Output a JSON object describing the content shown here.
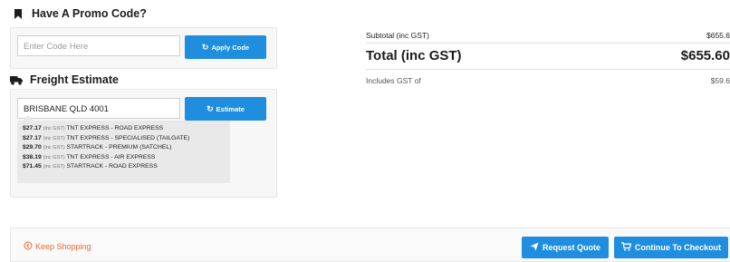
{
  "promo": {
    "title": "Have A Promo Code?",
    "input_placeholder": "Enter Code Here",
    "button_label": "Apply Code"
  },
  "freight": {
    "title": "Freight Estimate",
    "postcode_value": "BRISBANE QLD 4001",
    "button_label": "Estimate",
    "gst_tag": "(inc GST)",
    "options": [
      {
        "price": "$27.17",
        "service": "TNT EXPRESS - ROAD EXPRESS"
      },
      {
        "price": "$27.17",
        "service": "TNT EXPRESS - SPECIALISED (TAILGATE)"
      },
      {
        "price": "$29.70",
        "service": "STARTRACK - PREMIUM (SATCHEL)"
      },
      {
        "price": "$38.19",
        "service": "TNT EXPRESS - AIR EXPRESS"
      },
      {
        "price": "$71.45",
        "service": "STARTRACK - ROAD EXPRESS"
      }
    ]
  },
  "totals": {
    "subtotal_label": "Subtotal (inc GST)",
    "subtotal_value": "$655.6",
    "total_label": "Total (inc GST)",
    "total_value": "$655.60",
    "gst_label": "Includes GST of",
    "gst_value": "$59.6"
  },
  "footer": {
    "keep_shopping": "Keep Shopping",
    "request_quote": "Request Quote",
    "checkout": "Continue To Checkout"
  },
  "colors": {
    "accent_blue": "#1f8ede",
    "keep_shopping_orange": "#e8692f"
  },
  "icons": {
    "promo": "bookmark-icon",
    "freight": "truck-icon",
    "apply": "refresh-icon",
    "estimate": "refresh-icon",
    "keep_shopping": "circle-arrow-icon",
    "request_quote": "paper-plane-icon",
    "checkout": "cart-icon"
  }
}
